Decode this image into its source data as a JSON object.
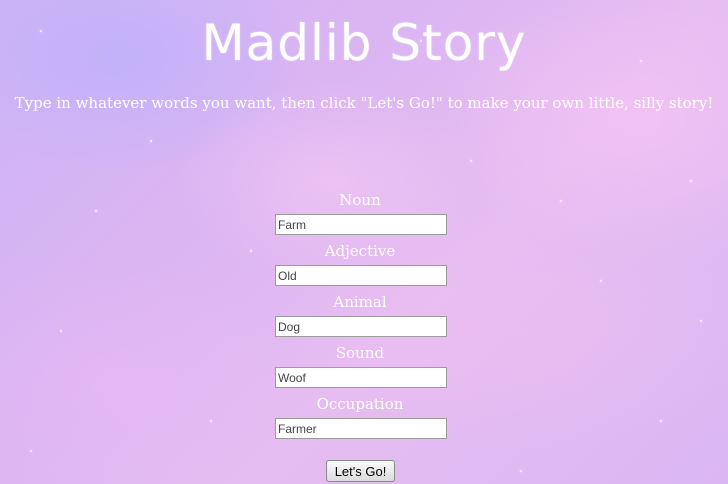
{
  "page": {
    "title": "Madlib Story",
    "subtitle": "Type in whatever words you want, then click \"Let's Go!\" to make your own little, silly story!"
  },
  "form": {
    "fields": [
      {
        "label": "Noun",
        "value": "Farm"
      },
      {
        "label": "Adjective",
        "value": "Old"
      },
      {
        "label": "Animal",
        "value": "Dog"
      },
      {
        "label": "Sound",
        "value": "Woof"
      },
      {
        "label": "Occupation",
        "value": "Farmer"
      }
    ],
    "submit_label": "Let's Go!"
  },
  "colors": {
    "text": "#ffffff",
    "background_start": "#cdb4f5",
    "background_end": "#e6bdf2"
  }
}
